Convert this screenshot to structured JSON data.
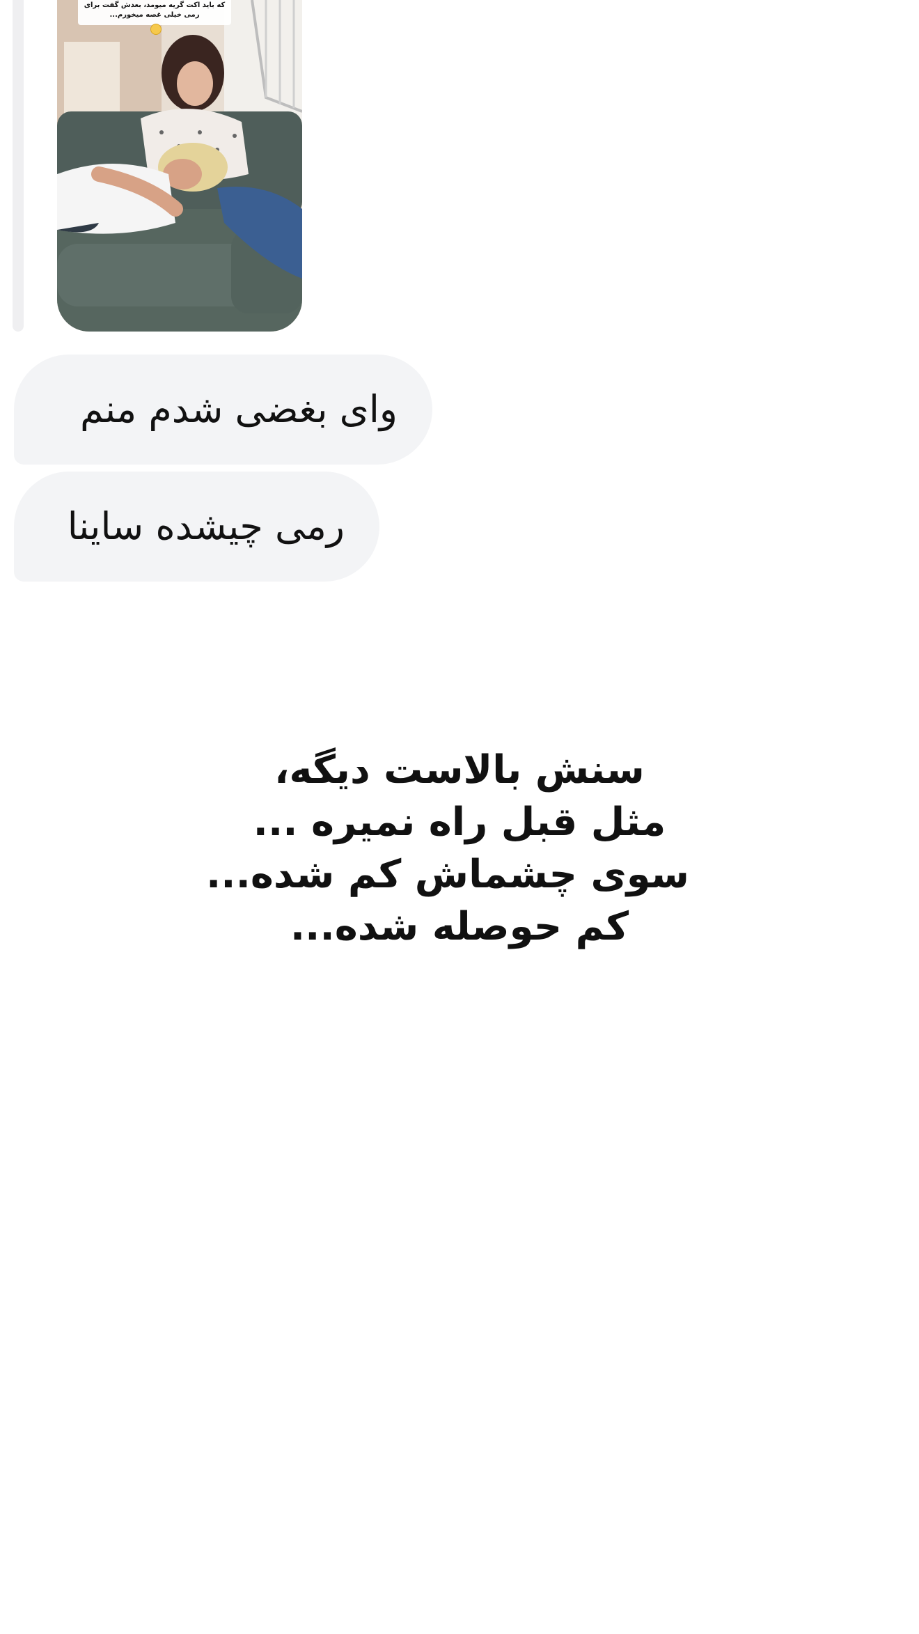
{
  "story_reply": {
    "caption_lines": [
      "که باید اکت گریه میومد، بعدش گفت برای",
      "رمی خیلی غصه میخورم..."
    ]
  },
  "messages": [
    {
      "text": "وای بغضی شدم منم"
    },
    {
      "text": "رمی چیشده ساینا"
    }
  ],
  "overlay_text": {
    "lines": [
      "سنش بالاست دیگه،",
      "مثل قبل راه نمیره ...",
      "سوی چشماش کم شده...",
      "کم حوصله شده..."
    ]
  },
  "colors": {
    "bubble_bg": "#f3f4f6",
    "reply_bar": "#efeff1",
    "text": "#111111",
    "background": "#ffffff"
  }
}
